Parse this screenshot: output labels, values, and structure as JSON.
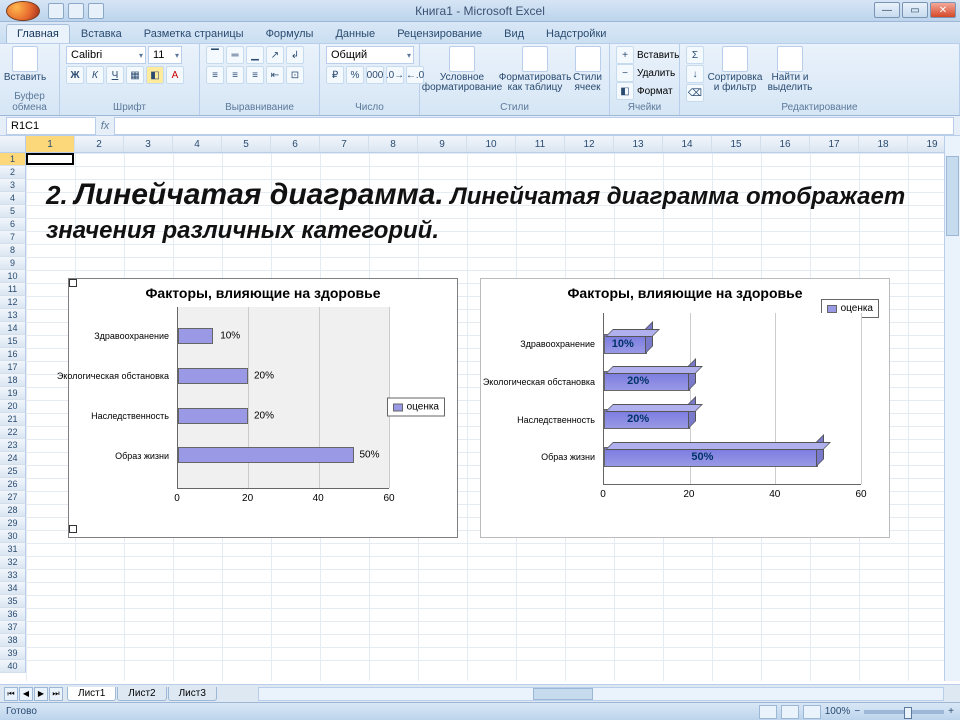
{
  "title": "Книга1 - Microsoft Excel",
  "tabs": [
    "Главная",
    "Вставка",
    "Разметка страницы",
    "Формулы",
    "Данные",
    "Рецензирование",
    "Вид",
    "Надстройки"
  ],
  "active_tab": 0,
  "ribbon_groups": {
    "clipboard": {
      "label": "Буфер обмена",
      "paste": "Вставить"
    },
    "font": {
      "label": "Шрифт",
      "name": "Calibri",
      "size": "11"
    },
    "align": {
      "label": "Выравнивание"
    },
    "number": {
      "label": "Число",
      "format": "Общий"
    },
    "styles": {
      "label": "Стили",
      "cond": "Условное форматирование",
      "table": "Форматировать как таблицу",
      "cell": "Стили ячеек"
    },
    "cells": {
      "label": "Ячейки",
      "insert": "Вставить",
      "delete": "Удалить",
      "format": "Формат"
    },
    "editing": {
      "label": "Редактирование",
      "sort": "Сортировка и фильтр",
      "find": "Найти и выделить"
    }
  },
  "namebox": "R1C1",
  "columns": [
    "1",
    "2",
    "3",
    "4",
    "5",
    "6",
    "7",
    "8",
    "9",
    "10",
    "11",
    "12",
    "13",
    "14",
    "15",
    "16",
    "17",
    "18",
    "19"
  ],
  "row_count": 40,
  "active_cell": {
    "row": 0,
    "col": 0
  },
  "heading": {
    "num": "2.",
    "bold": "Линейчатая диаграмма.",
    "rest": "Линейчатая диаграмма отображает значения различных категорий."
  },
  "sheets": [
    "Лист1",
    "Лист2",
    "Лист3"
  ],
  "status": "Готово",
  "zoom": "100%",
  "chart_data": [
    {
      "type": "bar",
      "title": "Факторы, влияющие на здоровье",
      "categories": [
        "Здравоохранение",
        "Экологическая обстановка",
        "Наследственность",
        "Образ жизни"
      ],
      "values": [
        10,
        20,
        20,
        50
      ],
      "value_labels": [
        "10%",
        "20%",
        "20%",
        "50%"
      ],
      "xlim": [
        0,
        60
      ],
      "xticks": [
        0,
        20,
        40,
        60
      ],
      "legend": "оценка",
      "style": "2d"
    },
    {
      "type": "bar",
      "title": "Факторы, влияющие на здоровье",
      "categories": [
        "Здравоохранение",
        "Экологическая обстановка",
        "Наследственность",
        "Образ жизни"
      ],
      "values": [
        10,
        20,
        20,
        50
      ],
      "value_labels": [
        "10%",
        "20%",
        "20%",
        "50%"
      ],
      "xlim": [
        0,
        60
      ],
      "xticks": [
        0,
        20,
        40,
        60
      ],
      "legend": "оценка",
      "style": "3d"
    }
  ]
}
